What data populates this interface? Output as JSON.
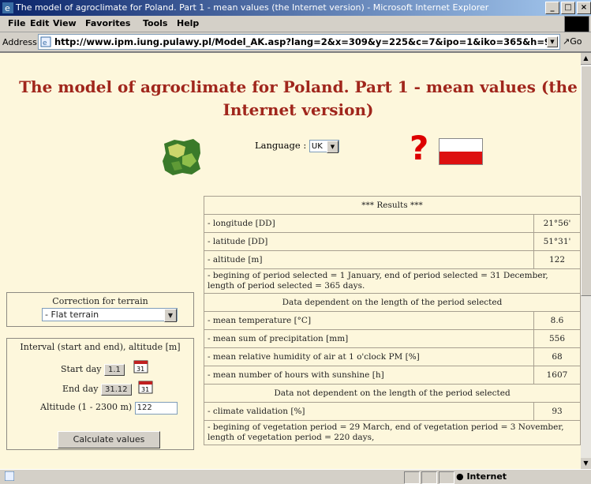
{
  "window": {
    "title": "The model of agroclimate for Poland. Part 1 - mean values (the Internet version) - Microsoft Internet Explorer"
  },
  "menubar": {
    "items": [
      "File",
      "Edit",
      "View",
      "Favorites",
      "Tools",
      "Help"
    ]
  },
  "address": {
    "label": "Address",
    "url": "http://www.ipm.iung.pulawy.pl/Model_AK.asp?lang=2&x=309&y=225&c=7&ipo=1&iko=365&h=99",
    "go": "Go"
  },
  "page": {
    "title": "The model of agroclimate for Poland. Part 1 - mean values (the Internet version)",
    "language_label": "Language :",
    "language_value": "UK",
    "help_symbol": "?"
  },
  "results": {
    "header": "*** Results ***",
    "longitude_label": "- longitude [DD]",
    "longitude_value": "21°56'",
    "latitude_label": "- latitude [DD]",
    "latitude_value": "51°31'",
    "altitude_label": "- altitude [m]",
    "altitude_value": "122",
    "period_text": "- begining of period selected = 1 January, end of period selected = 31 December, length of period selected = 365 days.",
    "dependent_header": "Data dependent on the length of the period selected",
    "temp_label": "- mean temperature [°C]",
    "temp_value": "8.6",
    "precip_label": "- mean sum of precipitation [mm]",
    "precip_value": "556",
    "humidity_label": "- mean relative humidity of air at 1 o'clock PM [%]",
    "humidity_value": "68",
    "sunshine_label": "- mean number of hours with sunshine [h]",
    "sunshine_value": "1607",
    "independent_header": "Data not dependent on the length of the period selected",
    "validation_label": "- climate validation [%]",
    "validation_value": "93",
    "vegetation_text": "- begining of vegetation period = 29 March, end of vegetation period = 3 November, length of vegetation period = 220 days,"
  },
  "sidebar": {
    "correction_header": "Correction for terrain",
    "terrain_value": "- Flat terrain",
    "interval_header": "Interval (start and end), altitude [m]",
    "start_label": "Start day",
    "start_value": "1.1",
    "end_label": "End day",
    "end_value": "31.12",
    "altitude_label": "Altitude (1 - 2300 m)",
    "altitude_value": "122",
    "calc_button": "Calculate values"
  },
  "status": {
    "zone": "Internet"
  },
  "colors": {
    "title_red": "#a0261c",
    "page_bg": "#fdf7dc"
  }
}
